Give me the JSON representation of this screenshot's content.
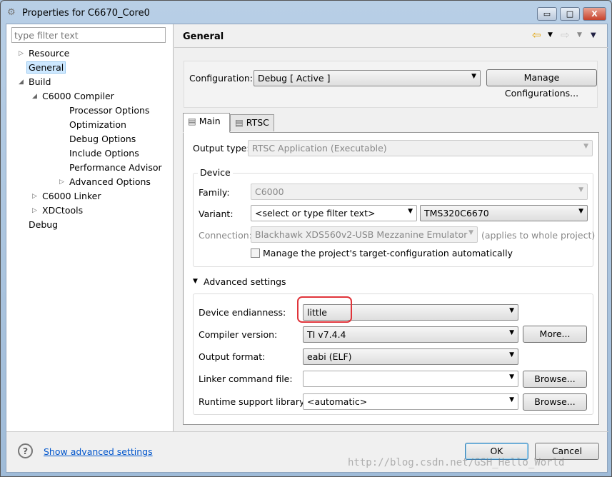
{
  "window": {
    "title": "Properties for C6670_Core0",
    "min": "▭",
    "max": "□",
    "close": "X"
  },
  "sidebar": {
    "filter_placeholder": "type filter text",
    "items": [
      {
        "label": "Resource",
        "level": 0,
        "twisty": "▷"
      },
      {
        "label": "General",
        "level": 0,
        "selected": true
      },
      {
        "label": "Build",
        "level": 0,
        "twisty": "◢"
      },
      {
        "label": "C6000 Compiler",
        "level": 1,
        "twisty": "◢"
      },
      {
        "label": "Processor Options",
        "level": 2
      },
      {
        "label": "Optimization",
        "level": 2
      },
      {
        "label": "Debug Options",
        "level": 2
      },
      {
        "label": "Include Options",
        "level": 2
      },
      {
        "label": "Performance Advisor",
        "level": 2
      },
      {
        "label": "Advanced Options",
        "level": 2,
        "twisty": "▷"
      },
      {
        "label": "C6000 Linker",
        "level": 1,
        "twisty": "▷"
      },
      {
        "label": "XDCtools",
        "level": 1,
        "twisty": "▷"
      },
      {
        "label": "Debug",
        "level": 0
      }
    ]
  },
  "header": {
    "title": "General"
  },
  "config": {
    "label": "Configuration:",
    "value": "Debug  [ Active ]",
    "manage": "Manage Configurations..."
  },
  "tabs": [
    {
      "label": "Main"
    },
    {
      "label": "RTSC"
    }
  ],
  "main": {
    "output_type_label": "Output type:",
    "output_type": "RTSC Application (Executable)",
    "device_group": "Device",
    "family_label": "Family:",
    "family": "C6000",
    "variant_label": "Variant:",
    "variant_filter": "<select or type filter text>",
    "variant": "TMS320C6670",
    "connection_label": "Connection:",
    "connection": "Blackhawk XDS560v2-USB Mezzanine Emulator",
    "connection_note": "(applies to whole project)",
    "manage_target": "Manage the project's target-configuration automatically",
    "advanced": "Advanced settings",
    "endianness_label": "Device endianness:",
    "endianness": "little",
    "compiler_label": "Compiler version:",
    "compiler": "TI v7.4.4",
    "more": "More...",
    "format_label": "Output format:",
    "format": "eabi (ELF)",
    "linker_label": "Linker command file:",
    "linker": "",
    "browse": "Browse...",
    "rts_label": "Runtime support library:",
    "rts": "<automatic>"
  },
  "footer": {
    "show_advanced": "Show advanced settings",
    "ok": "OK",
    "cancel": "Cancel"
  },
  "watermark": "http://blog.csdn.net/GSH_Hello_World",
  "colors": {
    "highlight": "#e0343a",
    "link": "#0055cc"
  }
}
